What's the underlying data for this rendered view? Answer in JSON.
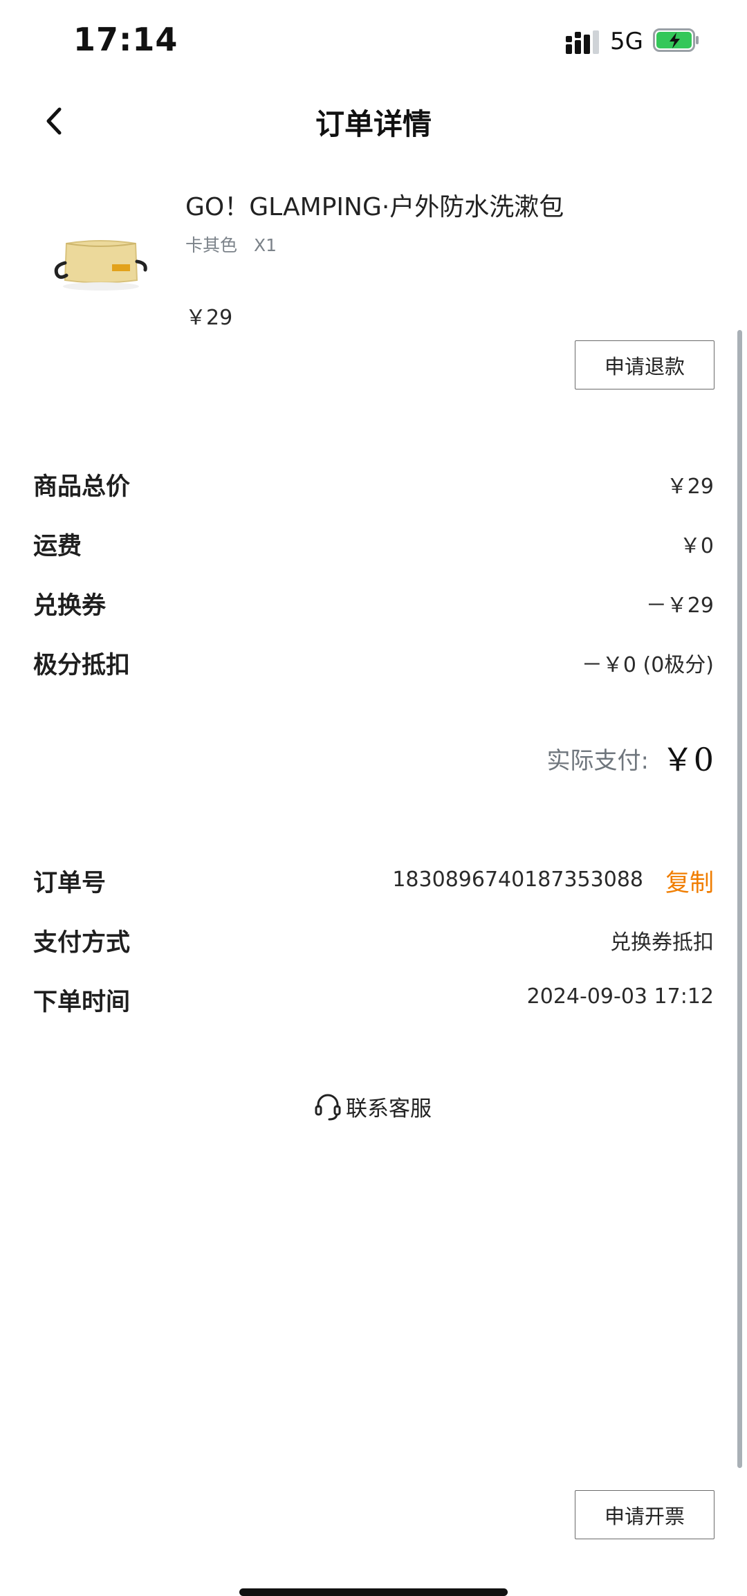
{
  "status_bar": {
    "time": "17:14",
    "network": "5G"
  },
  "nav": {
    "title": "订单详情"
  },
  "product": {
    "name": "GO！GLAMPING·户外防水洗漱包",
    "color": "卡其色",
    "quantity": "X1",
    "price": "￥29"
  },
  "buttons": {
    "refund": "申请退款",
    "invoice": "申请开票"
  },
  "summary": [
    {
      "label": "商品总价",
      "value": "￥29"
    },
    {
      "label": "运费",
      "value": "￥0"
    },
    {
      "label": "兑换券",
      "value": "－￥29"
    },
    {
      "label": "极分抵扣",
      "value": "－￥0 (0极分)"
    }
  ],
  "total": {
    "label": "实际支付:",
    "value": "￥0"
  },
  "order": {
    "number_label": "订单号",
    "number": "1830896740187353088",
    "copy_label": "复制",
    "payment_label": "支付方式",
    "payment": "兑换券抵扣",
    "time_label": "下单时间",
    "time": "2024-09-03 17:12"
  },
  "contact": {
    "label": "联系客服"
  },
  "colors": {
    "accent": "#f07d00",
    "battery": "#34c759"
  },
  "icons": [
    "back-icon",
    "headset-icon",
    "signal-icon",
    "battery-icon"
  ]
}
